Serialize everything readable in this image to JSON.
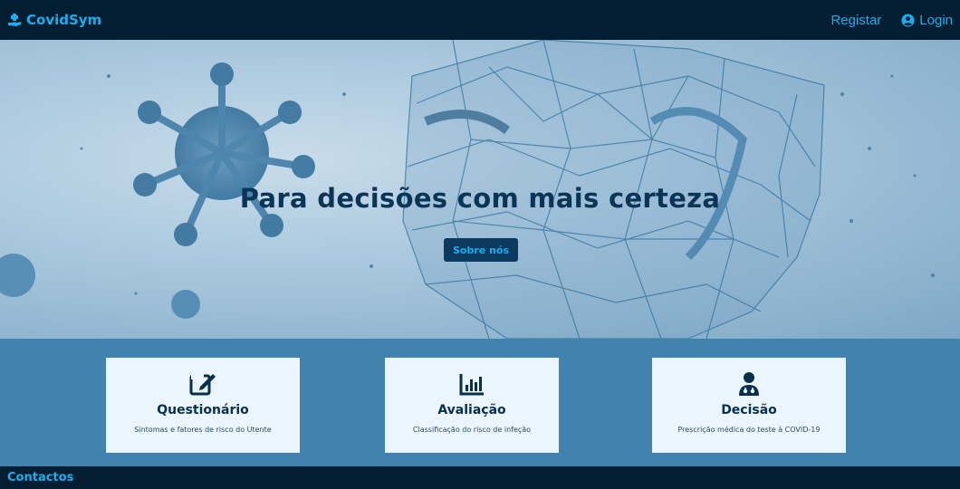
{
  "navbar": {
    "brand": "CovidSym",
    "register_label": "Registar",
    "login_label": "Login"
  },
  "hero": {
    "title": "Para decisões com mais certeza",
    "button_label": "Sobre nós"
  },
  "features": [
    {
      "icon": "edit-icon",
      "title": "Questionário",
      "description": "Sintomas e fatores de risco do Utente"
    },
    {
      "icon": "chart-bar-icon",
      "title": "Avaliação",
      "description": "Classificação do risco de infeção"
    },
    {
      "icon": "doctor-icon",
      "title": "Decisão",
      "description": "Prescrição médica do teste à COVID-19"
    }
  ],
  "footer": {
    "title": "Contactos"
  },
  "colors": {
    "navbar_bg": "#031d31",
    "accent": "#17aef0",
    "feature_band": "#4182ae",
    "card_bg": "#eaf5fd",
    "hero_text": "#0b3556"
  }
}
